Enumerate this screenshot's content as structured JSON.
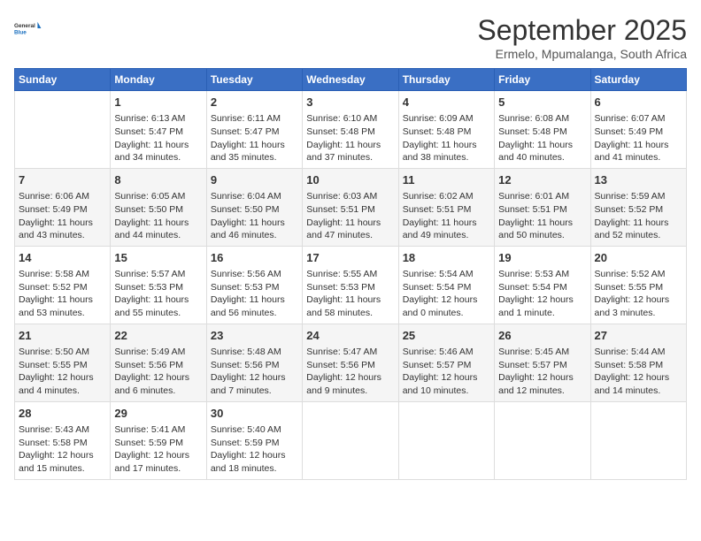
{
  "logo": {
    "line1": "General",
    "line2": "Blue"
  },
  "title": "September 2025",
  "subtitle": "Ermelo, Mpumalanga, South Africa",
  "headers": [
    "Sunday",
    "Monday",
    "Tuesday",
    "Wednesday",
    "Thursday",
    "Friday",
    "Saturday"
  ],
  "weeks": [
    [
      {
        "day": "",
        "data": ""
      },
      {
        "day": "1",
        "data": "Sunrise: 6:13 AM\nSunset: 5:47 PM\nDaylight: 11 hours\nand 34 minutes."
      },
      {
        "day": "2",
        "data": "Sunrise: 6:11 AM\nSunset: 5:47 PM\nDaylight: 11 hours\nand 35 minutes."
      },
      {
        "day": "3",
        "data": "Sunrise: 6:10 AM\nSunset: 5:48 PM\nDaylight: 11 hours\nand 37 minutes."
      },
      {
        "day": "4",
        "data": "Sunrise: 6:09 AM\nSunset: 5:48 PM\nDaylight: 11 hours\nand 38 minutes."
      },
      {
        "day": "5",
        "data": "Sunrise: 6:08 AM\nSunset: 5:48 PM\nDaylight: 11 hours\nand 40 minutes."
      },
      {
        "day": "6",
        "data": "Sunrise: 6:07 AM\nSunset: 5:49 PM\nDaylight: 11 hours\nand 41 minutes."
      }
    ],
    [
      {
        "day": "7",
        "data": "Sunrise: 6:06 AM\nSunset: 5:49 PM\nDaylight: 11 hours\nand 43 minutes."
      },
      {
        "day": "8",
        "data": "Sunrise: 6:05 AM\nSunset: 5:50 PM\nDaylight: 11 hours\nand 44 minutes."
      },
      {
        "day": "9",
        "data": "Sunrise: 6:04 AM\nSunset: 5:50 PM\nDaylight: 11 hours\nand 46 minutes."
      },
      {
        "day": "10",
        "data": "Sunrise: 6:03 AM\nSunset: 5:51 PM\nDaylight: 11 hours\nand 47 minutes."
      },
      {
        "day": "11",
        "data": "Sunrise: 6:02 AM\nSunset: 5:51 PM\nDaylight: 11 hours\nand 49 minutes."
      },
      {
        "day": "12",
        "data": "Sunrise: 6:01 AM\nSunset: 5:51 PM\nDaylight: 11 hours\nand 50 minutes."
      },
      {
        "day": "13",
        "data": "Sunrise: 5:59 AM\nSunset: 5:52 PM\nDaylight: 11 hours\nand 52 minutes."
      }
    ],
    [
      {
        "day": "14",
        "data": "Sunrise: 5:58 AM\nSunset: 5:52 PM\nDaylight: 11 hours\nand 53 minutes."
      },
      {
        "day": "15",
        "data": "Sunrise: 5:57 AM\nSunset: 5:53 PM\nDaylight: 11 hours\nand 55 minutes."
      },
      {
        "day": "16",
        "data": "Sunrise: 5:56 AM\nSunset: 5:53 PM\nDaylight: 11 hours\nand 56 minutes."
      },
      {
        "day": "17",
        "data": "Sunrise: 5:55 AM\nSunset: 5:53 PM\nDaylight: 11 hours\nand 58 minutes."
      },
      {
        "day": "18",
        "data": "Sunrise: 5:54 AM\nSunset: 5:54 PM\nDaylight: 12 hours\nand 0 minutes."
      },
      {
        "day": "19",
        "data": "Sunrise: 5:53 AM\nSunset: 5:54 PM\nDaylight: 12 hours\nand 1 minute."
      },
      {
        "day": "20",
        "data": "Sunrise: 5:52 AM\nSunset: 5:55 PM\nDaylight: 12 hours\nand 3 minutes."
      }
    ],
    [
      {
        "day": "21",
        "data": "Sunrise: 5:50 AM\nSunset: 5:55 PM\nDaylight: 12 hours\nand 4 minutes."
      },
      {
        "day": "22",
        "data": "Sunrise: 5:49 AM\nSunset: 5:56 PM\nDaylight: 12 hours\nand 6 minutes."
      },
      {
        "day": "23",
        "data": "Sunrise: 5:48 AM\nSunset: 5:56 PM\nDaylight: 12 hours\nand 7 minutes."
      },
      {
        "day": "24",
        "data": "Sunrise: 5:47 AM\nSunset: 5:56 PM\nDaylight: 12 hours\nand 9 minutes."
      },
      {
        "day": "25",
        "data": "Sunrise: 5:46 AM\nSunset: 5:57 PM\nDaylight: 12 hours\nand 10 minutes."
      },
      {
        "day": "26",
        "data": "Sunrise: 5:45 AM\nSunset: 5:57 PM\nDaylight: 12 hours\nand 12 minutes."
      },
      {
        "day": "27",
        "data": "Sunrise: 5:44 AM\nSunset: 5:58 PM\nDaylight: 12 hours\nand 14 minutes."
      }
    ],
    [
      {
        "day": "28",
        "data": "Sunrise: 5:43 AM\nSunset: 5:58 PM\nDaylight: 12 hours\nand 15 minutes."
      },
      {
        "day": "29",
        "data": "Sunrise: 5:41 AM\nSunset: 5:59 PM\nDaylight: 12 hours\nand 17 minutes."
      },
      {
        "day": "30",
        "data": "Sunrise: 5:40 AM\nSunset: 5:59 PM\nDaylight: 12 hours\nand 18 minutes."
      },
      {
        "day": "",
        "data": ""
      },
      {
        "day": "",
        "data": ""
      },
      {
        "day": "",
        "data": ""
      },
      {
        "day": "",
        "data": ""
      }
    ]
  ]
}
